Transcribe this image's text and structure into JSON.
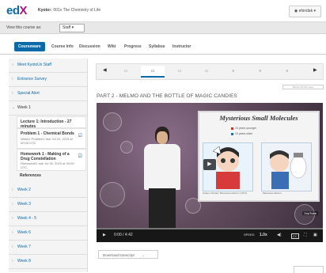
{
  "header": {
    "logo": "edX",
    "course_name": "Kyoto",
    "course_title": "x: 001x The Chemistry of Life",
    "user": "ehindak"
  },
  "viewbar": {
    "label": "View this course as:",
    "role": "Staff"
  },
  "tabs": [
    "Courseware",
    "Course Info",
    "Discussion",
    "Wiki",
    "Progress",
    "Syllabus",
    "Instructor"
  ],
  "sidebar": {
    "sections": [
      "Meet KyotoUx Staff",
      "Entrance Survey",
      "Special Alert",
      "Week 1",
      "Week 2",
      "Week 3",
      "Week 4 - 5",
      "Week 6",
      "Week 7",
      "Week 8"
    ],
    "subsections": [
      {
        "title": "Lecture 1: Introduction - 27 minutes",
        "detail": ""
      },
      {
        "title": "Problem 1 - Chemical Bonds",
        "detail": "Week1 Problem1 due Jul 22, 2015 at 00:00 UTC"
      },
      {
        "title": "Homework 1 - Making of a Drug Constellation",
        "detail": "Homework1 due Jul 30, 2015 at 00:00 UTC"
      },
      {
        "title": "References",
        "detail": ""
      }
    ]
  },
  "sequence": {
    "items": [
      "▭",
      "▭",
      "▭",
      "▭",
      "≡",
      "≡",
      "≡"
    ],
    "bookmark": "Bookmark this page"
  },
  "unit_title": "PART 2 - MELMO AND THE BOTTLE OF MAGIC CANDIES",
  "video": {
    "slide_title": "Mysterious Small Molecules",
    "legend_1": "10 years younger",
    "legend_2": "10 years older",
    "caption_1": "Osamu Tezuka \"Marvelous Melmo\" (1971)",
    "caption_2": "Marvelous Melmo",
    "time": "0:00 / 4:42",
    "speed_label": "SPEED",
    "speed": "1.0x",
    "cc": "CC",
    "youtube": "YouTube"
  },
  "transcript_button": "Download transcript"
}
